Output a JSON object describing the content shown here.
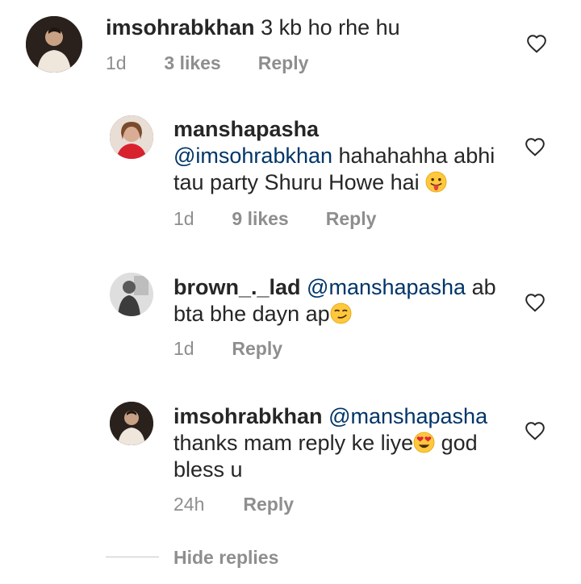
{
  "comments": [
    {
      "username": "imsohrabkhan",
      "mention": "",
      "text": "3 kb ho rhe hu",
      "time": "1d",
      "likes": "3 likes",
      "reply": "Reply"
    },
    {
      "username": "manshapasha",
      "mention": "@imsohrabkhan",
      "text_line1": "hahahahha abhi",
      "text_line2": "tau party Shuru Howe hai",
      "emoji": "face-with-tongue",
      "time": "1d",
      "likes": "9 likes",
      "reply": "Reply"
    },
    {
      "username": "brown_._lad",
      "mention": "@manshapasha",
      "text_line1": "ab",
      "text_line2": "bta bhe dayn ap",
      "emoji": "smirking-face",
      "time": "1d",
      "reply": "Reply"
    },
    {
      "username": "imsohrabkhan",
      "mention": "@manshapasha",
      "text_line1": "thanks mam reply ke liye",
      "text_line1b": "god",
      "text_line2": "bless u",
      "emoji": "heart-eyes-face",
      "time": "24h",
      "reply": "Reply"
    }
  ],
  "hide_replies": "Hide replies",
  "icons": {
    "like": "heart-outline-icon"
  },
  "colors": {
    "text": "#262626",
    "mention": "#003569",
    "meta": "#8e8e8e"
  }
}
